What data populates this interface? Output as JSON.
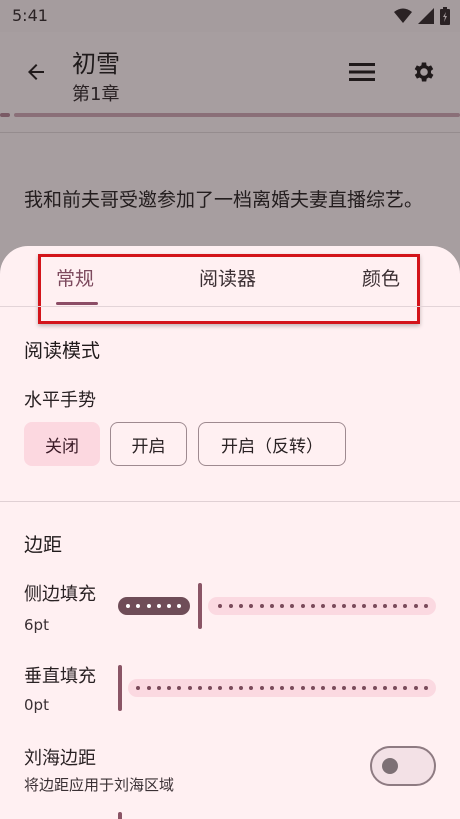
{
  "status": {
    "time": "5:41"
  },
  "app_bar": {
    "title": "初雪",
    "subtitle": "第1章"
  },
  "reader": {
    "text": "我和前夫哥受邀参加了一档离婚夫妻直播综艺。"
  },
  "sheet": {
    "tabs": [
      {
        "label": "常规",
        "active": true
      },
      {
        "label": "阅读器",
        "active": false
      },
      {
        "label": "颜色",
        "active": false
      }
    ],
    "reading_mode": {
      "title": "阅读模式",
      "horizontal_gesture_label": "水平手势",
      "options": [
        {
          "label": "关闭",
          "selected": true
        },
        {
          "label": "开启",
          "selected": false
        },
        {
          "label": "开启（反转）",
          "selected": false
        }
      ]
    },
    "margins": {
      "title": "边距",
      "side_padding": {
        "label": "侧边填充",
        "value": "6pt",
        "level": 6,
        "max": 30
      },
      "vertical_padding": {
        "label": "垂直填充",
        "value": "0pt",
        "level": 0,
        "max": 30
      },
      "notch": {
        "label": "刘海边距",
        "description": "将边距应用于刘海区域",
        "enabled": false
      }
    }
  },
  "colors": {
    "accent": "#8c4d66",
    "sheet_bg": "#fff0f2",
    "chip_selected": "#fcd8e0",
    "highlight": "#d3141b"
  }
}
